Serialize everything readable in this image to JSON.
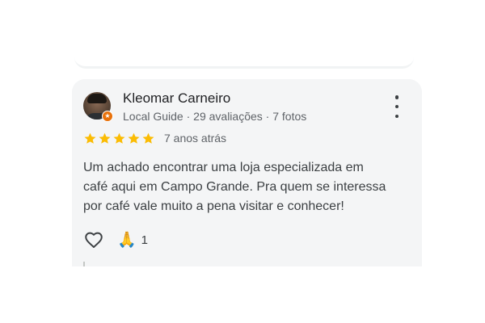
{
  "review": {
    "author_name": "Kleomar Carneiro",
    "author_meta": "Local Guide · 29 avaliações · 7 fotos",
    "rating": 5,
    "rating_max": 5,
    "time_ago": "7 anos atrás",
    "text_lines": [
      "Um achado encontrar uma loja especializada em",
      "café aqui em Campo Grande. Pra quem se interessa",
      "por café vale muito a pena visitar e conhecer!"
    ],
    "reaction_emoji": "🙏",
    "reaction_count": "1"
  },
  "icons": {
    "avatar": "user-avatar-photo",
    "badge": "local-guide-badge-icon",
    "more": "more-vert-icon",
    "star": "star-icon",
    "like": "heart-outline-icon"
  },
  "colors": {
    "star": "#fbbc04",
    "badge": "#e8710a",
    "card_bg": "#f4f5f6",
    "meta_text": "#5f6368"
  }
}
